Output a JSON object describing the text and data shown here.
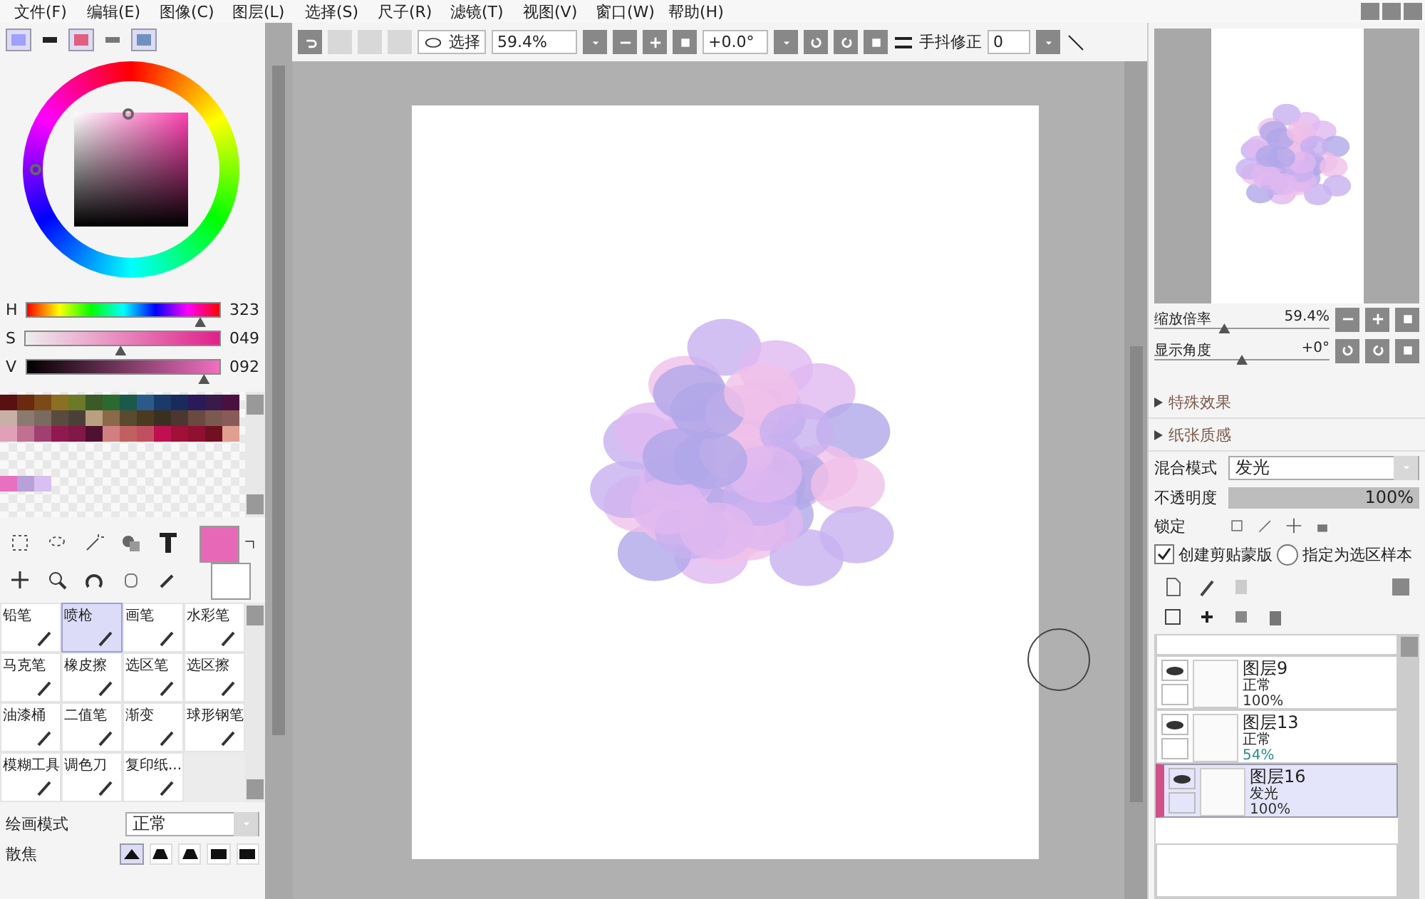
{
  "menu": [
    "文件(F)",
    "编辑(E)",
    "图像(C)",
    "图层(L)",
    "选择(S)",
    "尺子(R)",
    "滤镜(T)",
    "视图(V)",
    "窗口(W)",
    "帮助(H)"
  ],
  "color_modes": [
    {
      "selected": true
    },
    {
      "selected": false
    },
    {
      "selected": true
    },
    {
      "selected": false
    },
    {
      "selected": true
    }
  ],
  "hsv": [
    {
      "label": "H",
      "value": "323",
      "level": 0.9
    },
    {
      "label": "S",
      "value": "049",
      "level": 0.49
    },
    {
      "label": "V",
      "value": "092",
      "level": 0.92
    }
  ],
  "palette": [
    [
      {
        "color": "#5a1010"
      },
      {
        "color": "#6a2a10"
      },
      {
        "color": "#7a4a18"
      },
      {
        "color": "#8a7020"
      },
      {
        "color": "#6a7a28"
      },
      {
        "color": "#3a5a28"
      },
      {
        "color": "#2a6a30"
      },
      {
        "color": "#1a5a4a"
      },
      {
        "color": "#2a5a8a"
      },
      {
        "color": "#1a3a6a"
      },
      {
        "color": "#1a2a5a"
      },
      {
        "color": "#2a1a5a"
      },
      {
        "color": "#3a1a4a"
      },
      {
        "color": "#4a1040"
      }
    ],
    [
      {
        "color": "#c8b0a8"
      },
      {
        "color": "#8a7a70"
      },
      {
        "color": "#7a6a60"
      },
      {
        "color": "#5a4a40"
      },
      {
        "color": "#4a4038"
      },
      {
        "color": "#b8a080"
      },
      {
        "color": "#8a6a48"
      },
      {
        "color": "#5a4a30"
      },
      {
        "color": "#4a3a20"
      },
      {
        "color": "#3a3020"
      },
      {
        "color": "#4a3830"
      },
      {
        "color": "#6a4a40"
      },
      {
        "color": "#7a5a50"
      },
      {
        "color": "#8a5a58"
      }
    ],
    [
      {
        "color": "#e0a0b8"
      },
      {
        "color": "#c07090"
      },
      {
        "color": "#a04070"
      },
      {
        "color": "#901a50"
      },
      {
        "color": "#801848"
      },
      {
        "color": "#501030"
      },
      {
        "color": "#d08080"
      },
      {
        "color": "#c06060"
      },
      {
        "color": "#c05060"
      },
      {
        "color": "#c01050"
      },
      {
        "color": "#a01038"
      },
      {
        "color": "#901030"
      },
      {
        "color": "#701020"
      },
      {
        "color": "#e0a090"
      }
    ],
    [
      {
        "color": "#e870c0"
      },
      {
        "color": "#b8a0d8"
      },
      {
        "color": "#d8c0f0"
      }
    ]
  ],
  "primary_color": {
    "color": "#e868b8"
  },
  "brushes": [
    {
      "label": "铅笔",
      "selected": false
    },
    {
      "label": "喷枪",
      "selected": true
    },
    {
      "label": "画笔",
      "selected": false
    },
    {
      "label": "水彩笔",
      "selected": false
    },
    {
      "label": "马克笔",
      "selected": false
    },
    {
      "label": "橡皮擦",
      "selected": false
    },
    {
      "label": "选区笔",
      "selected": false
    },
    {
      "label": "选区擦",
      "selected": false
    },
    {
      "label": "油漆桶",
      "selected": false
    },
    {
      "label": "二值笔",
      "selected": false
    },
    {
      "label": "渐变",
      "selected": false
    },
    {
      "label": "球形钢笔",
      "selected": false
    },
    {
      "label": "模糊工具",
      "selected": false
    },
    {
      "label": "调色刀",
      "selected": false
    },
    {
      "label": "复印纸...",
      "selected": false
    }
  ],
  "draw_mode": {
    "label": "绘画模式",
    "value": "正常"
  },
  "blur": {
    "label": "散焦",
    "shapes": [
      {
        "selected": true
      },
      {
        "selected": false
      },
      {
        "selected": false
      },
      {
        "selected": false
      },
      {
        "selected": false
      }
    ]
  },
  "toolbar": {
    "select_label": "选择",
    "zoom": "59.4%",
    "angle": "+0.0°",
    "stabilizer_label": "手抖修正",
    "stabilizer": "0"
  },
  "navigator": {
    "zoom": {
      "label": "缩放倍率",
      "value": "59.4%",
      "level": 0.4
    },
    "angle": {
      "label": "显示角度",
      "value": "+0°",
      "level": 0.5
    }
  },
  "sections": [
    {
      "label": "特殊效果",
      "expanded": false
    },
    {
      "label": "纸张质感",
      "expanded": false
    }
  ],
  "blend": {
    "label": "混合模式",
    "value": "发光"
  },
  "opacity": {
    "label": "不透明度",
    "value": "100%",
    "level": 1.0
  },
  "lock": {
    "label": "锁定"
  },
  "clipping": {
    "label": "创建剪贴蒙版",
    "checked": true
  },
  "sample": {
    "label": "指定为选区样本",
    "selected": false
  },
  "layers": [
    {
      "name": "图层9",
      "mode": "正常",
      "opacity": "100%",
      "visible": true,
      "selected": false,
      "color": "#333333"
    },
    {
      "name": "图层13",
      "mode": "正常",
      "opacity": "54%",
      "visible": true,
      "selected": false,
      "color": "#2a8a8a"
    },
    {
      "name": "图层16",
      "mode": "发光",
      "opacity": "100%",
      "visible": true,
      "selected": true,
      "color": "#333333"
    }
  ]
}
